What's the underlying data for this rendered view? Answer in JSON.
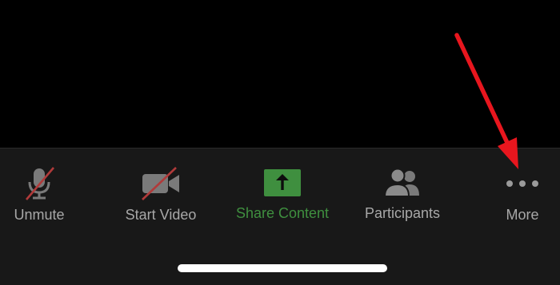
{
  "toolbar": {
    "items": [
      {
        "label": "Unmute",
        "icon": "microphone-muted-icon"
      },
      {
        "label": "Start Video",
        "icon": "video-off-icon"
      },
      {
        "label": "Share Content",
        "icon": "share-upload-icon"
      },
      {
        "label": "Participants",
        "icon": "participants-icon"
      },
      {
        "label": "More",
        "icon": "more-dots-icon"
      }
    ]
  },
  "colors": {
    "background": "#000000",
    "toolbar_background": "#181818",
    "label_gray": "#a8a8a8",
    "share_green": "#3f8f3f",
    "mute_strike_red": "#b03a3a",
    "annotation_arrow_red": "#e8161e",
    "home_indicator": "#ffffff"
  }
}
